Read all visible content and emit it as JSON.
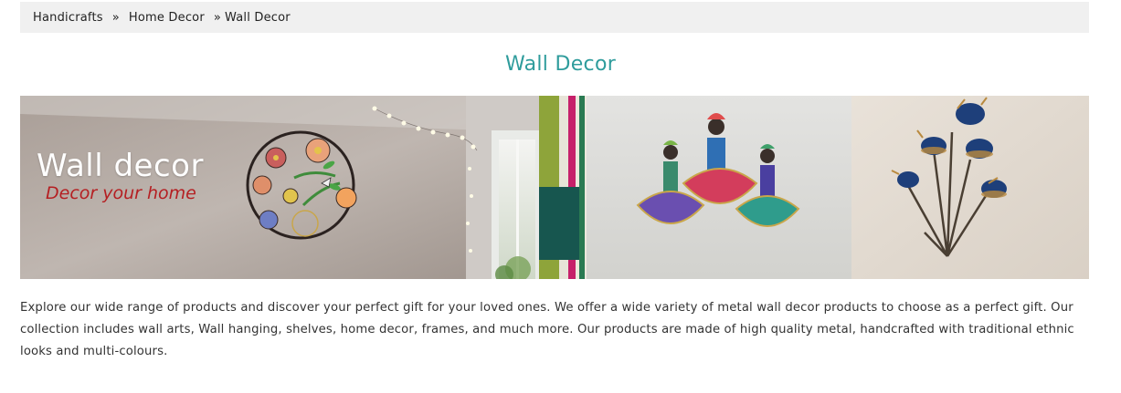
{
  "breadcrumb": {
    "items": [
      "Handicrafts",
      "Home Decor",
      "Wall Decor"
    ],
    "separator": "»"
  },
  "page": {
    "title": "Wall Decor",
    "title_color": "#2f9c9c"
  },
  "banner": {
    "heading": "Wall decor",
    "subheading": "Decor your home",
    "subheading_color": "#b51f22"
  },
  "description": "Explore our wide range of products and discover your perfect gift for your loved ones. We offer a wide variety of metal wall decor products to choose as a perfect gift. Our collection includes wall arts, Wall hanging, shelves, home decor, frames, and much more. Our products are made of high quality metal, handcrafted with traditional ethnic looks and multi-colours."
}
